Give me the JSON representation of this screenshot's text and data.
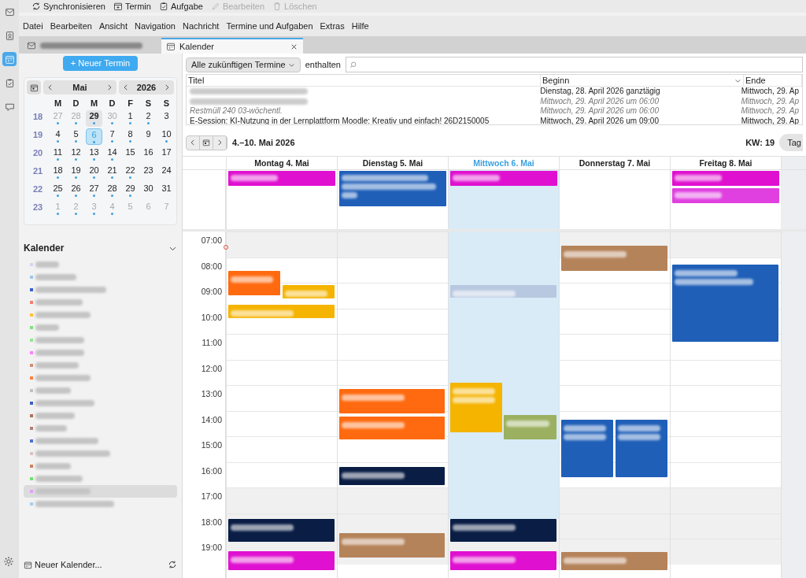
{
  "rail": [
    {
      "kind": "mail",
      "selected": false
    },
    {
      "kind": "contacts",
      "selected": false
    },
    {
      "kind": "calendar",
      "selected": true
    },
    {
      "kind": "tasks",
      "selected": false
    },
    {
      "kind": "chat",
      "selected": false
    }
  ],
  "toolbar": [
    {
      "kind": "sync",
      "label": "Synchronisieren",
      "disabled": false
    },
    {
      "kind": "event",
      "label": "Termin",
      "disabled": false
    },
    {
      "kind": "task",
      "label": "Aufgabe",
      "disabled": false
    },
    {
      "kind": "edit",
      "label": "Bearbeiten",
      "disabled": true
    },
    {
      "kind": "delete",
      "label": "Löschen",
      "disabled": true
    }
  ],
  "menu": [
    "Datei",
    "Bearbeiten",
    "Ansicht",
    "Navigation",
    "Nachricht",
    "Termine und Aufgaben",
    "Extras",
    "Hilfe"
  ],
  "tabs": [
    {
      "kind": "mail",
      "selected": false
    },
    {
      "kind": "calendar",
      "label": "Kalender",
      "selected": true
    }
  ],
  "sidebar": {
    "new_event": "+ Neuer Termin",
    "month": "Mai",
    "year": "2026",
    "weekdays": [
      "M",
      "D",
      "M",
      "D",
      "F",
      "S",
      "S"
    ],
    "weeks": [
      {
        "week": "18",
        "days": [
          {
            "d": "27",
            "other": true,
            "dot": true
          },
          {
            "d": "28",
            "other": true,
            "dot": true
          },
          {
            "d": "29",
            "today": true,
            "dot": true
          },
          {
            "d": "30",
            "other": true,
            "dot": true
          },
          {
            "d": "1",
            "dot": true
          },
          {
            "d": "2",
            "dot": true
          },
          {
            "d": "3",
            "dot": false
          }
        ]
      },
      {
        "week": "19",
        "days": [
          {
            "d": "4",
            "dot": true
          },
          {
            "d": "5",
            "dot": true
          },
          {
            "d": "6",
            "selected": true,
            "dot": true
          },
          {
            "d": "7",
            "dot": true
          },
          {
            "d": "8",
            "dot": true
          },
          {
            "d": "9",
            "dot": false
          },
          {
            "d": "10",
            "dot": true
          }
        ]
      },
      {
        "week": "20",
        "days": [
          {
            "d": "11",
            "dot": true
          },
          {
            "d": "12",
            "dot": true
          },
          {
            "d": "13",
            "dot": true
          },
          {
            "d": "14",
            "dot": true
          },
          {
            "d": "15",
            "dot": false
          },
          {
            "d": "16",
            "dot": false
          },
          {
            "d": "17",
            "dot": false
          }
        ]
      },
      {
        "week": "21",
        "days": [
          {
            "d": "18",
            "dot": true
          },
          {
            "d": "19",
            "dot": true
          },
          {
            "d": "20",
            "dot": true
          },
          {
            "d": "21",
            "dot": true
          },
          {
            "d": "22",
            "dot": true
          },
          {
            "d": "23",
            "dot": false
          },
          {
            "d": "24",
            "dot": false
          }
        ]
      },
      {
        "week": "22",
        "days": [
          {
            "d": "25",
            "dot": true
          },
          {
            "d": "26",
            "dot": true
          },
          {
            "d": "27",
            "dot": true
          },
          {
            "d": "28",
            "dot": true
          },
          {
            "d": "29",
            "dot": true
          },
          {
            "d": "30",
            "dot": false
          },
          {
            "d": "31",
            "dot": false
          }
        ]
      },
      {
        "week": "23",
        "days": [
          {
            "d": "1",
            "other": true,
            "dot": true
          },
          {
            "d": "2",
            "other": true,
            "dot": true
          },
          {
            "d": "3",
            "other": true,
            "dot": true
          },
          {
            "d": "4",
            "other": true,
            "dot": true
          },
          {
            "d": "5",
            "other": true,
            "dot": false
          },
          {
            "d": "6",
            "other": true,
            "dot": false
          },
          {
            "d": "7",
            "other": true,
            "dot": false
          }
        ]
      }
    ],
    "calendars_title": "Kalender",
    "calendars": [
      {
        "color": "#d0d8ee",
        "selected": false
      },
      {
        "color": "#9cc7ee",
        "selected": false
      },
      {
        "color": "#3a5fc8",
        "selected": false
      },
      {
        "color": "#f08070",
        "selected": false
      },
      {
        "color": "#ffc040",
        "selected": false
      },
      {
        "color": "#80e080",
        "selected": false
      },
      {
        "color": "#90e890",
        "selected": false
      },
      {
        "color": "#ff80ff",
        "selected": false
      },
      {
        "color": "#d09070",
        "selected": false
      },
      {
        "color": "#ff8040",
        "selected": false
      },
      {
        "color": "#c0c0c0",
        "selected": false
      },
      {
        "color": "#4060c0",
        "selected": false
      },
      {
        "color": "#b07060",
        "selected": false
      },
      {
        "color": "#b08070",
        "selected": false
      },
      {
        "color": "#5070d0",
        "selected": false
      },
      {
        "color": "#e0c0c0",
        "selected": false
      },
      {
        "color": "#d08060",
        "selected": false
      },
      {
        "color": "#70e070",
        "selected": false
      },
      {
        "color": "#e0a0ff",
        "selected": true
      },
      {
        "color": "#a0d0f0",
        "selected": false
      }
    ],
    "new_calendar": "Neuer Kalender..."
  },
  "filter": {
    "range": "Alle zukünftigen Termine",
    "contains": "enthalten"
  },
  "agenda": {
    "columns": [
      "Titel",
      "Beginn",
      "Ende"
    ],
    "rows": [
      {
        "start": "Dienstag, 28. April 2026 ganztägig",
        "end": "Mittwoch, 29. Ap",
        "dimmed": false
      },
      {
        "start": "Mittwoch, 29. April 2026 um 06:00",
        "end": "Mittwoch, 29. Ap",
        "dimmed": true
      },
      {
        "title": "Restmüll 240 03-wöchentl.",
        "start": "Mittwoch, 29. April 2026 um 06:00",
        "end": "Mittwoch, 29. Ap",
        "dimmed": true
      },
      {
        "title": "E-Session: KI-Nutzung in der Lernplattform Moodle: Kreativ und einfach! 26D2150005",
        "start": "Mittwoch, 29. April 2026 um 09:00",
        "end": "Mittwoch, 29. Ap",
        "dimmed": false
      }
    ]
  },
  "week": {
    "range": "4.–10. Mai 2026",
    "kw": "KW: 19",
    "view_tab": "Tag",
    "days": [
      {
        "label": "Montag 4. Mai",
        "today": false,
        "allday": [
          {
            "color": "#e010d0"
          }
        ],
        "events": [
          {
            "color": "#ff6a10"
          },
          {
            "color": "#f5b400"
          },
          {
            "color": "#f5b400"
          },
          {
            "color": "#0a1e45"
          },
          {
            "color": "#e010d0"
          }
        ]
      },
      {
        "label": "Dienstag 5. Mai",
        "today": false,
        "allday": [
          {
            "color": "#1f5fb8"
          }
        ],
        "events": [
          {
            "color": "#ff6a10"
          },
          {
            "color": "#ff6a10"
          },
          {
            "color": "#0a1e45"
          },
          {
            "color": "#b5835a"
          }
        ]
      },
      {
        "label": "Mittwoch 6. Mai",
        "today": true,
        "allday": [
          {
            "color": "#e010d0"
          }
        ],
        "events": [
          {
            "color": "#b8c8e0"
          },
          {
            "color": "#f5b400"
          },
          {
            "color": "#9bb060"
          },
          {
            "color": "#0a1e45"
          },
          {
            "color": "#e010d0"
          }
        ]
      },
      {
        "label": "Donnerstag 7. Mai",
        "today": false,
        "events": [
          {
            "color": "#b5835a"
          },
          {
            "color": "#1f5fb8"
          },
          {
            "color": "#1f5fb8"
          },
          {
            "color": "#b5835a"
          }
        ]
      },
      {
        "label": "Freitag 8. Mai",
        "today": false,
        "allday": [
          {
            "color": "#e010d0"
          },
          {
            "color": "#e040e0"
          }
        ],
        "events": [
          {
            "color": "#1f5fb8"
          }
        ]
      }
    ],
    "hours": [
      "07:00",
      "08:00",
      "09:00",
      "10:00",
      "11:00",
      "12:00",
      "13:00",
      "14:00",
      "15:00",
      "16:00",
      "17:00",
      "18:00",
      "19:00"
    ]
  }
}
